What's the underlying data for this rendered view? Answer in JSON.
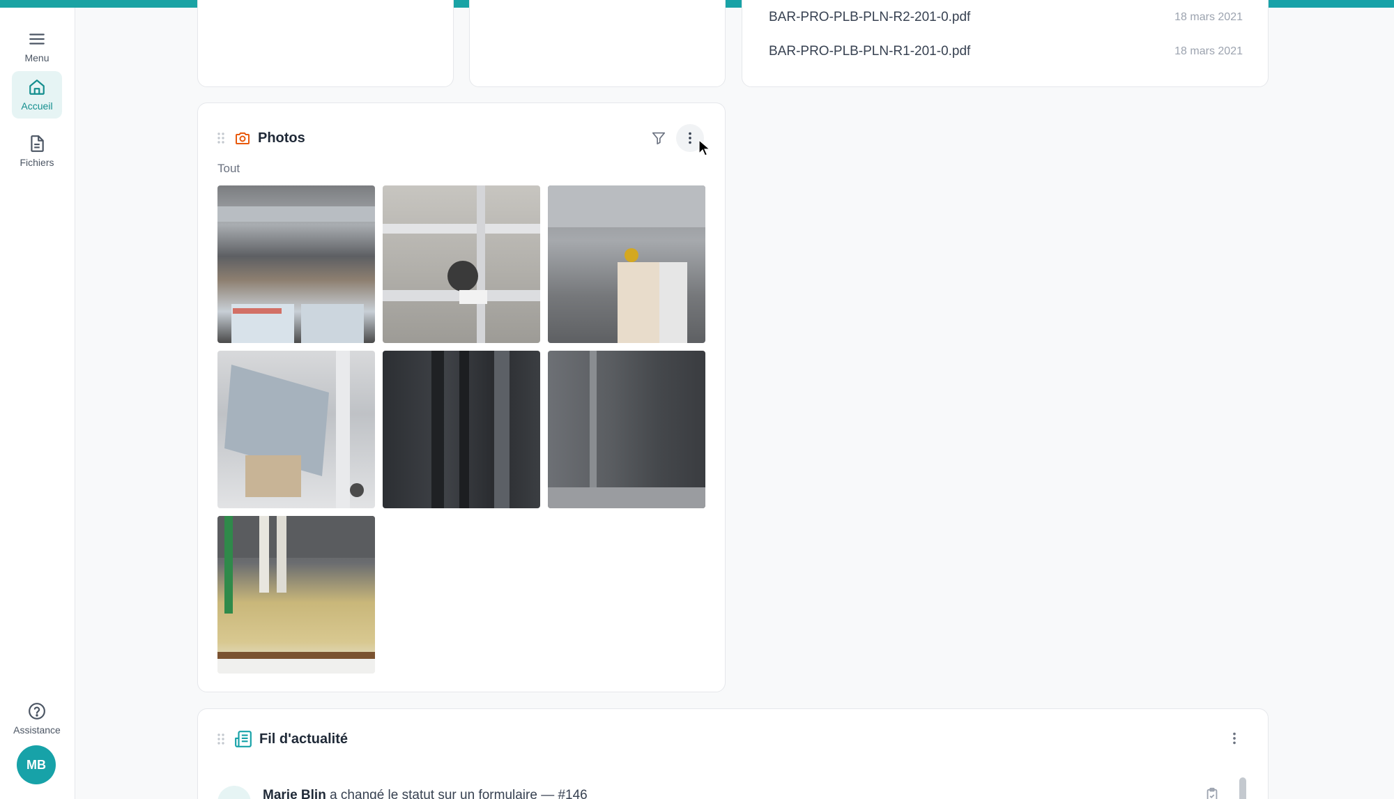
{
  "sidebar": {
    "menu_label": "Menu",
    "items": [
      {
        "label": "Accueil",
        "icon": "home-icon",
        "active": true
      },
      {
        "label": "Fichiers",
        "icon": "file-icon",
        "active": false
      }
    ],
    "assistance_label": "Assistance",
    "avatar_initials": "MB"
  },
  "files": [
    {
      "name": "BAR-PRO-PLB-PLN-R2-201-0.pdf",
      "date": "18 mars 2021"
    },
    {
      "name": "BAR-PRO-PLB-PLN-R1-201-0.pdf",
      "date": "18 mars 2021"
    }
  ],
  "photos_widget": {
    "title": "Photos",
    "filter_label": "Tout",
    "photo_count": 7
  },
  "news_widget": {
    "title": "Fil d'actualité",
    "entry": {
      "author": "Marie Blin",
      "action": " a changé le statut sur un formulaire — #146"
    }
  },
  "colors": {
    "accent": "#17a2a8",
    "photos_icon": "#e8590c"
  }
}
